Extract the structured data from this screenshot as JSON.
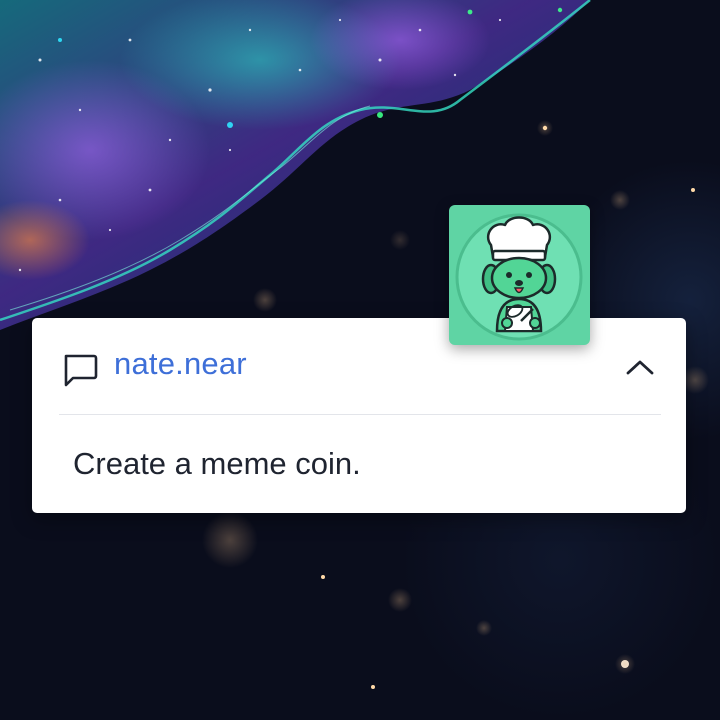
{
  "post": {
    "author": "nate.near",
    "message": "Create a meme coin."
  },
  "icons": {
    "comment": "chat-bubble-icon",
    "collapse": "chevron-up-icon",
    "avatar": "chef-dog-avatar"
  },
  "colors": {
    "author_link": "#3e6fd8",
    "message_text": "#1f2430",
    "avatar_bg": "#5fd4a4",
    "background": "#0a0d1c"
  }
}
